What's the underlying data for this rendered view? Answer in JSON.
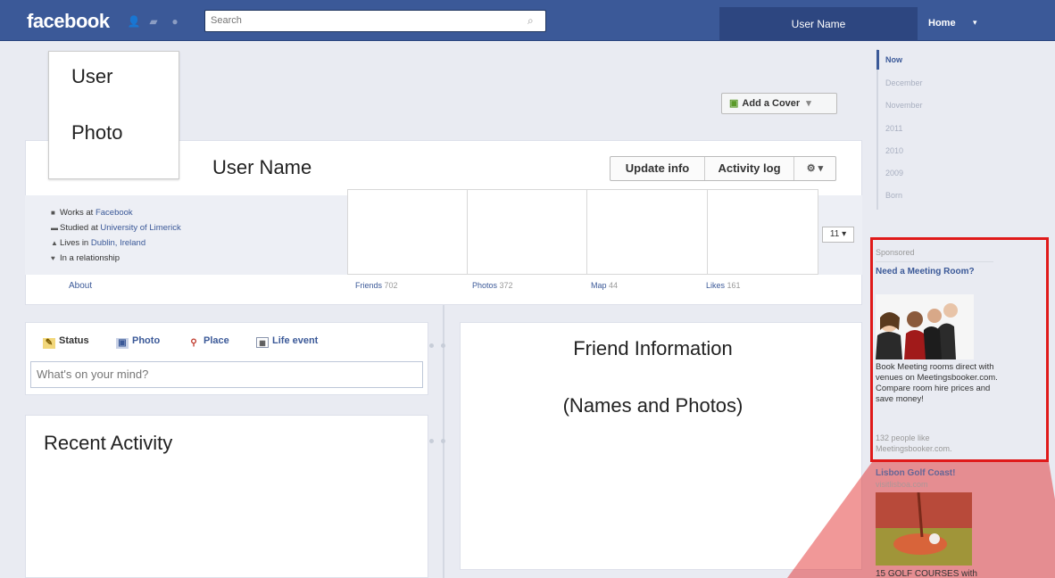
{
  "topbar": {
    "logo": "facebook",
    "search_placeholder": "Search",
    "user_name": "User Name",
    "home_label": "Home",
    "home_caret": "▾"
  },
  "profile": {
    "photo_line1": "User",
    "photo_line2": "Photo",
    "name": "User Name",
    "add_cover": "Add a Cover",
    "add_cover_caret": "▾",
    "update_info": "Update info",
    "activity_log": "Activity log",
    "settings_label": "⚙ ▾",
    "info": [
      {
        "prefix": "Works at ",
        "link": "Facebook"
      },
      {
        "prefix": "Studied at ",
        "link": "University of Limerick"
      },
      {
        "prefix": "Lives in ",
        "link": "Dublin, Ireland"
      },
      {
        "prefix": "In a relationship",
        "link": ""
      }
    ],
    "about": "About",
    "tiles": [
      {
        "label": "Friends",
        "count": "702"
      },
      {
        "label": "Photos",
        "count": "372"
      },
      {
        "label": "Map",
        "count": "44"
      },
      {
        "label": "Likes",
        "count": "161"
      }
    ],
    "more_count": "11 ▾"
  },
  "composer": {
    "tabs": [
      "Status",
      "Photo",
      "Place",
      "Life event"
    ],
    "placeholder": "What's on your mind?"
  },
  "recent_activity": "Recent Activity",
  "friend_info": {
    "line1": "Friend Information",
    "line2": "(Names and Photos)"
  },
  "date_nav": [
    "Now",
    "December",
    "November",
    "2011",
    "2010",
    "2009",
    "Born"
  ],
  "sponsored": {
    "header": "Sponsored",
    "title": "Need a Meeting Room?",
    "body": "Book Meeting rooms direct with venues on Meetingsbooker.com. Compare room hire prices and save money!",
    "likes": "132 people like Meetingsbooker.com.",
    "ad2_title": "Lisbon Golf Coast!",
    "ad2_domain": "visitlisboa.com",
    "ad2_text": "15 GOLF COURSES with"
  },
  "colors": {
    "brand": "#3b5998",
    "highlight": "#e01a1a"
  }
}
